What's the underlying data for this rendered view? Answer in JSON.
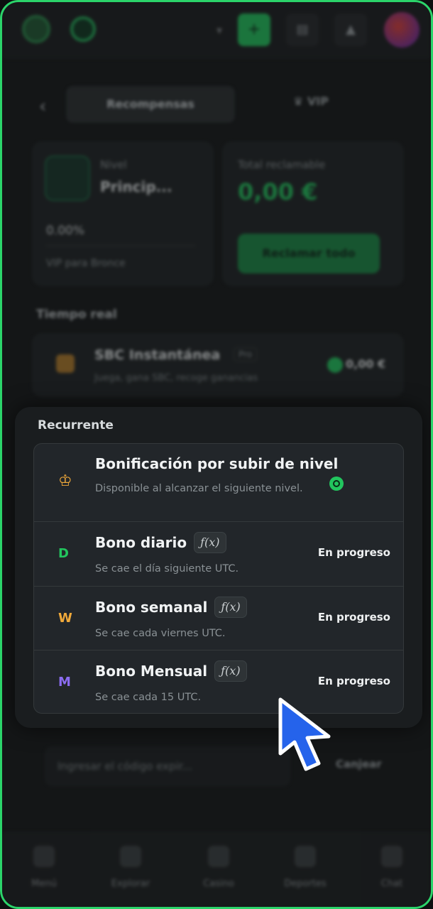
{
  "topbar": {
    "logo_icon": "brand-logo",
    "chevron": "▾",
    "add_icon": "plus",
    "plus_glyph": "+",
    "wallet_icon": "wallet-icon",
    "bell_icon": "bell-icon",
    "avatar_icon": "avatar"
  },
  "tabs": {
    "back_icon": "‹",
    "rewards_label": "Recompensas",
    "vip_label": "VIP"
  },
  "level_card": {
    "label": "Nivel",
    "name": "Princip...",
    "progress": "0.00%",
    "vip_link": "VIP para Bronce"
  },
  "total_card": {
    "label": "Total reclamable",
    "value": "0,00 €",
    "claim_label": "Reclamar todo"
  },
  "realtime": {
    "heading": "Tiempo real",
    "item_title": "SBC Instantánea",
    "item_tag": "Pro",
    "item_sub": "Juega, gana SBC, recoge ganancias",
    "item_value": "0,00 €"
  },
  "modal": {
    "title": "Recurrente",
    "rows": [
      {
        "icon_glyph": "♔",
        "icon_name": "crown-icon",
        "icon_color": "#f0a93a",
        "title": "Bonificación por subir de nivel",
        "sub": "Disponible al alcanzar el siguiente nivel.",
        "status": ""
      },
      {
        "icon_glyph": "D",
        "icon_color": "#22c55e",
        "title": "Bono diario",
        "fx": "ƒ(x)",
        "sub": "Se cae el día siguiente UTC.",
        "status": "En progreso"
      },
      {
        "icon_glyph": "W",
        "icon_color": "#f0a93a",
        "title": "Bono semanal",
        "fx": "ƒ(x)",
        "sub": "Se cae cada viernes UTC.",
        "status": "En progreso"
      },
      {
        "icon_glyph": "M",
        "icon_color": "#8b6cf0",
        "title": "Bono Mensual",
        "fx": "ƒ(x)",
        "sub": "Se cae cada 15 UTC.",
        "status": "En progreso"
      }
    ]
  },
  "promo": {
    "placeholder": "Ingresar el código expir...",
    "button_label": "Canjear"
  },
  "bottom_nav": {
    "items": [
      {
        "label": "Menú",
        "icon": "menu-icon"
      },
      {
        "label": "Explorar",
        "icon": "search-icon"
      },
      {
        "label": "Casino",
        "icon": "casino-icon"
      },
      {
        "label": "Deportes",
        "icon": "sports-icon"
      },
      {
        "label": "Chat",
        "icon": "chat-icon"
      }
    ]
  },
  "colors": {
    "accent": "#22c55e",
    "frame": "#2bd46a",
    "cursor": "#2563eb"
  }
}
